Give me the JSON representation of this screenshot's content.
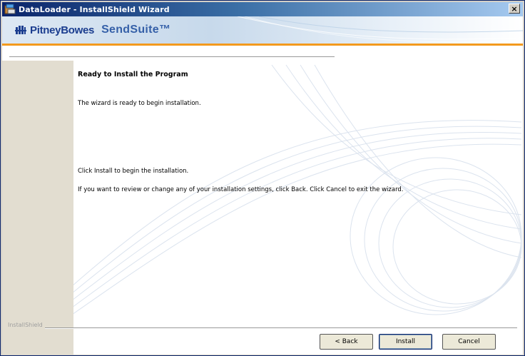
{
  "window": {
    "title": "DataLoader - InstallShield Wizard",
    "close_symbol": "×"
  },
  "banner": {
    "company": "PitneyBowes",
    "product": "SendSuite™"
  },
  "content": {
    "heading": "Ready to Install the Program",
    "line1": "The wizard is ready to begin installation.",
    "line2": "Click Install to begin the installation.",
    "line3": "If you want to review or change any of your installation settings, click Back. Click Cancel to exit the wizard."
  },
  "footer": {
    "installshield_label": "InstallShield",
    "back_label": "< Back",
    "install_label": "Install",
    "cancel_label": "Cancel"
  },
  "icons": {
    "title_icon": "installer-icon",
    "brand_icon": "pitney-bowes-logo-icon",
    "close_icon": "close-icon"
  },
  "colors": {
    "title_bar": "#0a246a",
    "accent_orange": "#f39a1e",
    "sidebar": "#e2ddd0"
  }
}
